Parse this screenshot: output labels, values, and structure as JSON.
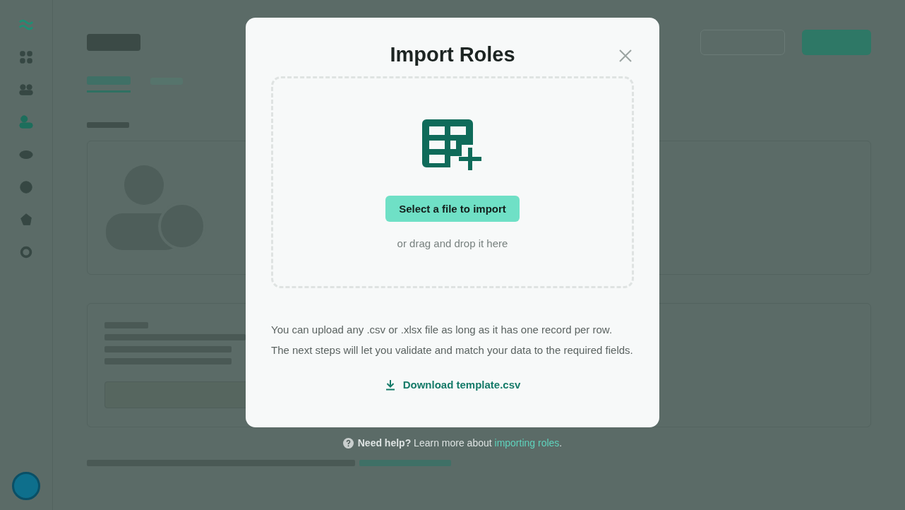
{
  "sidebar": {
    "items": [
      {
        "selected": false
      },
      {
        "selected": false
      },
      {
        "selected": true
      },
      {
        "selected": false
      },
      {
        "selected": false
      },
      {
        "selected": false
      },
      {
        "selected": false
      }
    ]
  },
  "dialog": {
    "title": "Import Roles",
    "select_button": "Select a file to import",
    "drop_hint": "or drag and drop it here",
    "notes": [
      "You can upload any .csv or .xlsx file as long as it has one record per row.",
      "The next steps will let you validate and match your data to the required fields."
    ],
    "download": "Download template.csv"
  },
  "help": {
    "text": "**Need help?** Learn more about",
    "link": "importing roles",
    "end": "."
  }
}
